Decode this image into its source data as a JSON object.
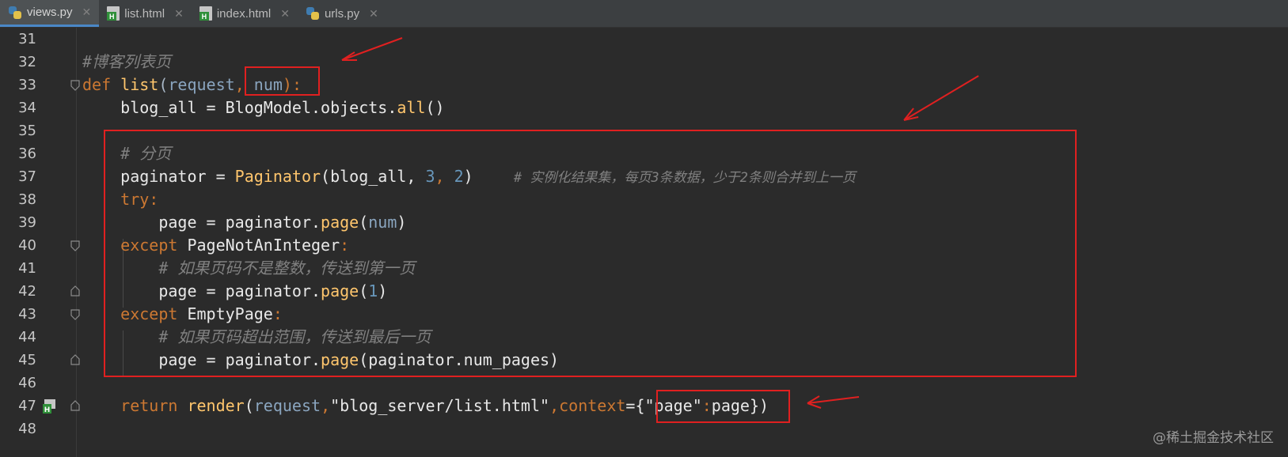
{
  "tabs": [
    {
      "label": "views.py",
      "icon": "python-file-icon",
      "active": true
    },
    {
      "label": "list.html",
      "icon": "html-file-icon",
      "active": false
    },
    {
      "label": "index.html",
      "icon": "html-file-icon",
      "active": false
    },
    {
      "label": "urls.py",
      "icon": "python-file-icon",
      "active": false
    }
  ],
  "close_glyph": "✕",
  "lines": [
    {
      "n": "31"
    },
    {
      "n": "32",
      "t": [
        "#博客列表页"
      ]
    },
    {
      "n": "33",
      "t": [
        "def",
        " ",
        "list",
        "(",
        "request",
        ",",
        " ",
        "num",
        "):"
      ]
    },
    {
      "n": "34",
      "t": [
        "    blog_all = BlogModel.objects.",
        "all",
        "()"
      ]
    },
    {
      "n": "35"
    },
    {
      "n": "36",
      "t": [
        "    # 分页"
      ]
    },
    {
      "n": "37",
      "t": [
        "    paginator = ",
        "Paginator",
        "(blog_all, ",
        "3",
        ", ",
        "2",
        ")",
        "     # 实例化结果集，每页3条数据，少于2条则合并到上一页"
      ]
    },
    {
      "n": "38",
      "t": [
        "    ",
        "try",
        ":"
      ]
    },
    {
      "n": "39",
      "t": [
        "        page = paginator.",
        "page",
        "(",
        "num",
        ")"
      ]
    },
    {
      "n": "40",
      "t": [
        "    ",
        "except",
        " PageNotAnInteger",
        ":"
      ]
    },
    {
      "n": "41",
      "t": [
        "        # 如果页码不是整数，传送到第一页"
      ]
    },
    {
      "n": "42",
      "t": [
        "        page = paginator.",
        "page",
        "(",
        "1",
        ")"
      ]
    },
    {
      "n": "43",
      "t": [
        "    ",
        "except",
        " EmptyPage",
        ":"
      ]
    },
    {
      "n": "44",
      "t": [
        "        # 如果页码超出范围，传送到最后一页"
      ]
    },
    {
      "n": "45",
      "t": [
        "        page = paginator.",
        "page",
        "(paginator.num_pages)"
      ]
    },
    {
      "n": "46"
    },
    {
      "n": "47",
      "t": [
        "    ",
        "return",
        " ",
        "render",
        "(",
        "request",
        ",",
        "\"blog_server/list.html\"",
        ",",
        "context",
        "=",
        "{",
        "\"page\"",
        ":",
        "page",
        "}",
        ")"
      ]
    },
    {
      "n": "48"
    }
  ],
  "watermark": "@稀土掘金技术社区",
  "colors": {
    "background": "#2b2b2b",
    "keyword": "#cc7832",
    "function": "#ffc66d",
    "number": "#6897bb",
    "string": "#6a8759",
    "comment": "#808080",
    "annotation": "#e02020"
  }
}
